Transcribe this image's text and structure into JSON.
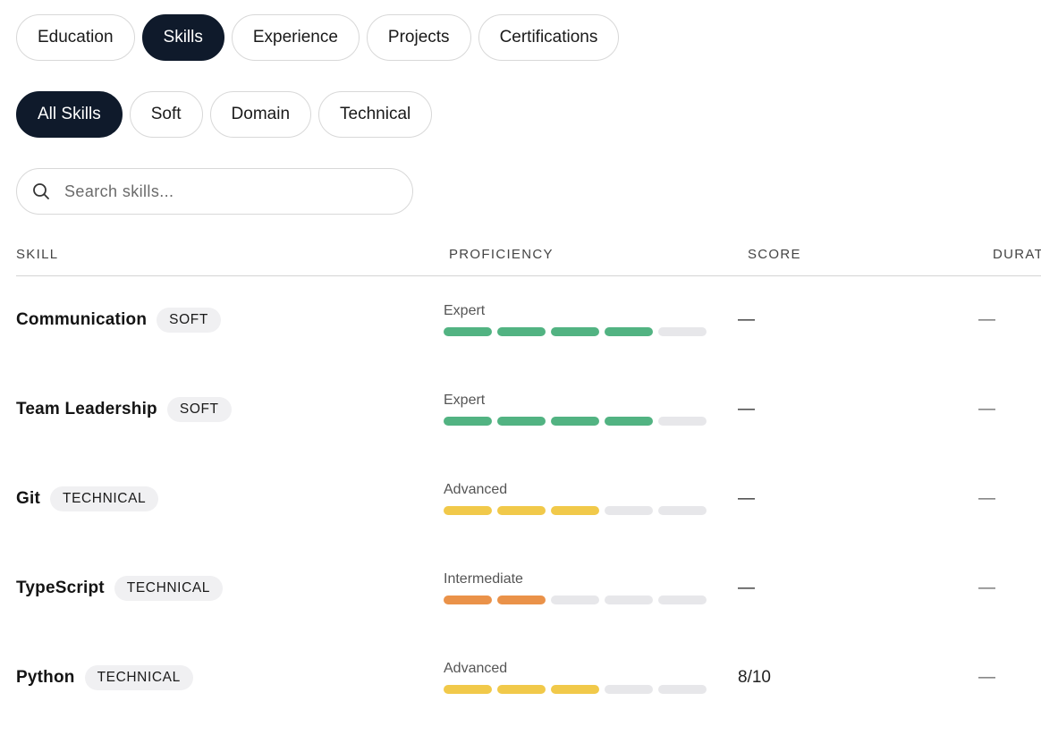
{
  "sections": [
    "Education",
    "Skills",
    "Experience",
    "Projects",
    "Certifications"
  ],
  "active_section": "Skills",
  "filters": [
    "All Skills",
    "Soft",
    "Domain",
    "Technical"
  ],
  "active_filter": "All Skills",
  "search": {
    "placeholder": "Search skills..."
  },
  "columns": {
    "skill": "SKILL",
    "proficiency": "PROFICIENCY",
    "score": "SCORE",
    "duration": "DURAT"
  },
  "levels": {
    "Expert": {
      "filled": 4,
      "color": "#52b382"
    },
    "Advanced": {
      "filled": 3,
      "color": "#f1c94a"
    },
    "Intermediate": {
      "filled": 2,
      "color": "#ea9249"
    }
  },
  "segments_total": 5,
  "empty_color": "#e7e7ea",
  "rows": [
    {
      "skill": "Communication",
      "category": "SOFT",
      "proficiency": "Expert",
      "score": "—",
      "duration": "—"
    },
    {
      "skill": "Team Leadership",
      "category": "SOFT",
      "proficiency": "Expert",
      "score": "—",
      "duration": "—"
    },
    {
      "skill": "Git",
      "category": "TECHNICAL",
      "proficiency": "Advanced",
      "score": "—",
      "duration": "—"
    },
    {
      "skill": "TypeScript",
      "category": "TECHNICAL",
      "proficiency": "Intermediate",
      "score": "—",
      "duration": "—"
    },
    {
      "skill": "Python",
      "category": "TECHNICAL",
      "proficiency": "Advanced",
      "score": "8/10",
      "duration": "—"
    }
  ]
}
